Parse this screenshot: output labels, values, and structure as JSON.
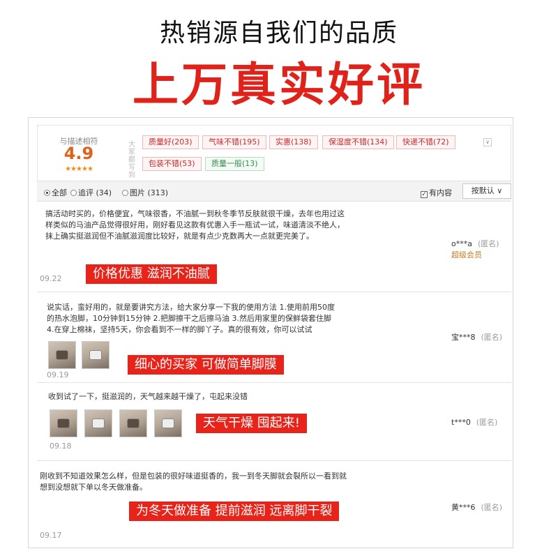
{
  "headline": {
    "line1": "热销源自我们的品质",
    "line2": "上万真实好评"
  },
  "rating": {
    "caption": "与描述相符",
    "score": "4.9",
    "stars": "★★★★★",
    "impression_label": "大家都写到",
    "expand_icon": "chevron-down-icon",
    "tags": [
      {
        "label": "质量好(203)",
        "tone": "positive"
      },
      {
        "label": "气味不错(195)",
        "tone": "positive"
      },
      {
        "label": "实惠(138)",
        "tone": "positive"
      },
      {
        "label": "保湿度不错(134)",
        "tone": "positive"
      },
      {
        "label": "快递不错(72)",
        "tone": "positive"
      },
      {
        "label": "包装不错(53)",
        "tone": "positive"
      },
      {
        "label": "质量一般(13)",
        "tone": "neutral"
      }
    ]
  },
  "filters": {
    "all": "全部",
    "followup": "追评 (34)",
    "pictures": "图片 (313)",
    "has_content": "有内容",
    "sort": "按默认 ∨"
  },
  "reviews": [
    {
      "text": "搞活动时买的，价格便宜，气味很香，不油腻一到秋冬季节反肤就很干燥，去年也用过这样类似的马油产品觉得很好用，刚好看见这款有优惠入手一瓶试一试，味道清淡不绝人，抹上确实挺滋润但不油腻滋润度比较好，就是有点少克数再大一点就更完美了。",
      "banner": "价格优惠 滋润不油腻",
      "date": "09.22",
      "user": "o***a",
      "anon": "(匿名)",
      "vip": "超级会员"
    },
    {
      "text": "说实话，蛮好用的，就是要讲究方法，给大家分享一下我的使用方法 1.使用前用50度的热水泡脚，10分钟到15分钟 2.把脚擦干之后擦马油 3.然后用家里的保鲜袋套住脚 4.在穿上棉袜，坚持5天，你会看到不一样的脚丫子。真的很有效，你可以试试",
      "banner": "细心的买家 可做简单脚膜",
      "date": "09.19",
      "user": "宝***8",
      "anon": "(匿名)"
    },
    {
      "text": "收到试了一下，挺滋润的，天气越来越干燥了，屯起来没错",
      "banner": "天气干燥 囤起来!",
      "date": "09.18",
      "user": "t***0",
      "anon": "(匿名)"
    },
    {
      "text": "刚收到不知道效果怎么样，但是包装的很好味道挺香的，我一到冬天脚就会裂所以一看到就想到没想就下单以冬天做准备。",
      "banner": "为冬天做准备 提前滋润 远离脚干裂",
      "date": "09.17",
      "user": "黄***6",
      "anon": "(匿名)"
    }
  ]
}
